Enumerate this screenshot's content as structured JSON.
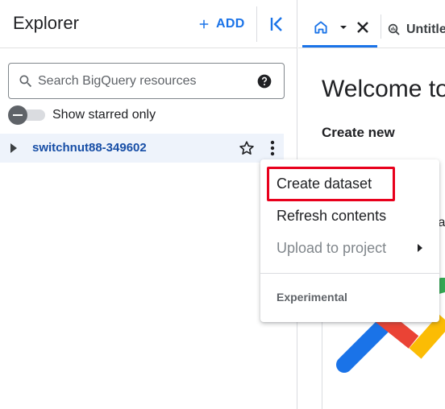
{
  "explorer": {
    "title": "Explorer",
    "add_label": "ADD",
    "search_placeholder": "Search BigQuery resources",
    "toggle_label": "Show starred only",
    "project_name": "switchnut88-349602"
  },
  "tabs": {
    "untitled_label": "Untitle"
  },
  "welcome": {
    "title": "Welcome to",
    "create_new": "Create new",
    "peek_text": "la"
  },
  "context_menu": {
    "items": [
      {
        "label": "Create dataset"
      },
      {
        "label": "Refresh contents"
      },
      {
        "label": "Upload to project"
      }
    ],
    "section_label": "Experimental"
  },
  "icons": {
    "add": "plus-icon",
    "collapse": "collapse-left-icon",
    "search": "search-icon",
    "help": "help-icon",
    "expand": "caret-right-icon",
    "star": "star-outline-icon",
    "more": "more-vert-icon",
    "home": "home-icon",
    "dropdown": "arrow-drop-down-icon",
    "close": "close-icon",
    "query": "query-icon",
    "submenu": "submenu-arrow-icon"
  },
  "colors": {
    "accent": "#1a73e8",
    "project_text": "#174ea6",
    "selected_row_bg": "#eef3fb",
    "highlight": "#e8001c"
  }
}
